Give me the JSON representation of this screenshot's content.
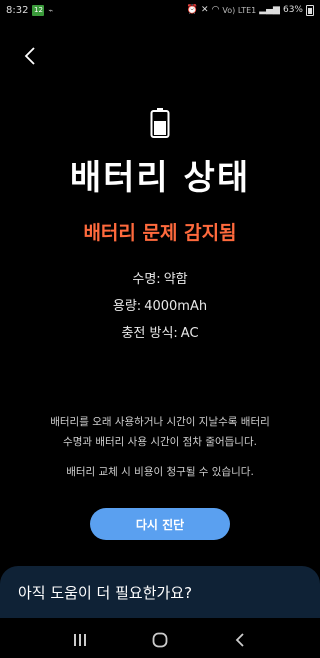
{
  "status_bar": {
    "time": "8:32",
    "calendar_day": "12",
    "network": "Vo) LTE1",
    "battery_percent": "63%"
  },
  "title": "배터리 상태",
  "status_headline": "배터리 문제 감지됨",
  "status_color": "#ff6a3d",
  "info": {
    "lifespan_label": "수명:",
    "lifespan_value": "약함",
    "capacity_label": "용량:",
    "capacity_value": "4000mAh",
    "charging_label": "충전 방식:",
    "charging_value": "AC"
  },
  "description": {
    "line1": "배터리를 오래 사용하거나 시간이 지날수록 배터리",
    "line2": "수명과 배터리 사용 시간이 점차 줄어듭니다.",
    "line3": "배터리 교체 시 비용이 청구될 수 있습니다."
  },
  "buttons": {
    "rediagnose": "다시 진단"
  },
  "help_prompt": "아직 도움이 더 필요한가요?",
  "accent_color": "#5aa0f0",
  "icons": [
    "back-icon",
    "battery-icon",
    "recents-icon",
    "home-icon",
    "nav-back-icon"
  ]
}
